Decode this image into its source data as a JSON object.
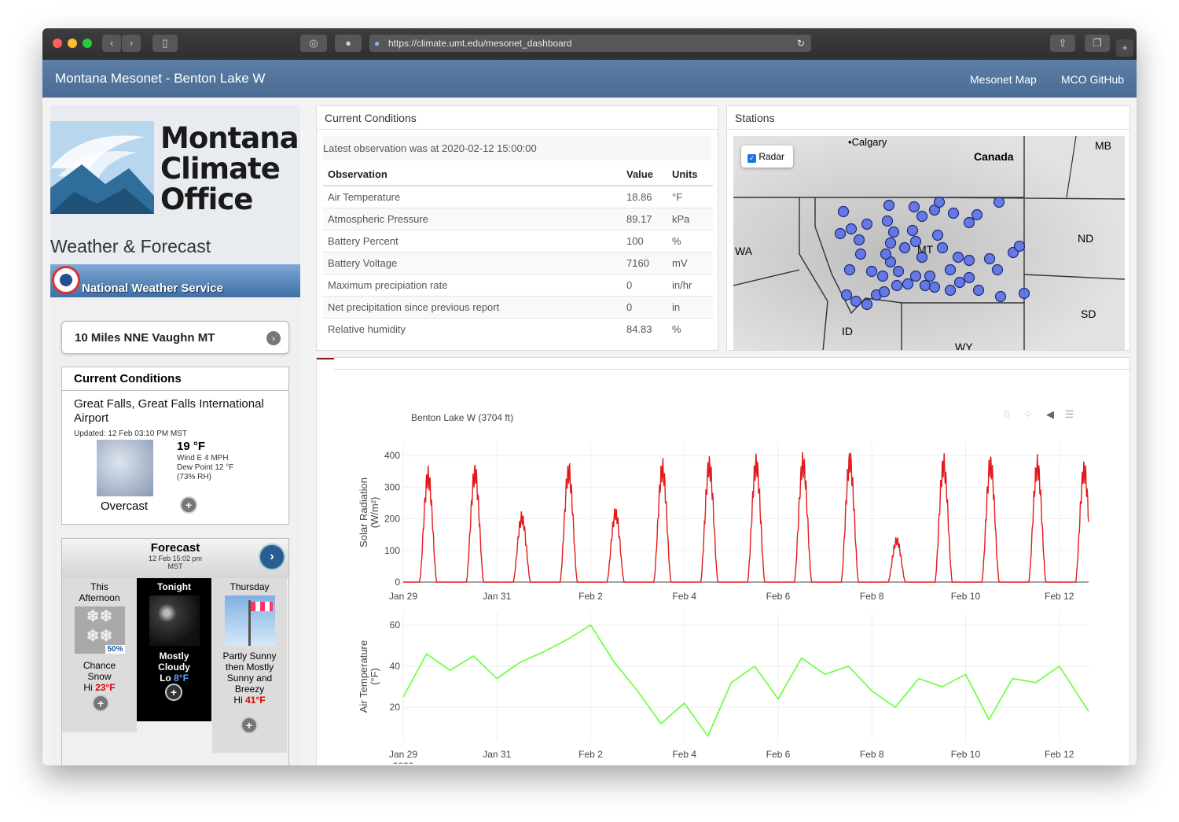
{
  "browser": {
    "url": "https://climate.umt.edu/mesonet_dashboard"
  },
  "app": {
    "title": "Montana Mesonet - Benton Lake W",
    "nav": [
      "Mesonet Map",
      "MCO GitHub"
    ]
  },
  "sidebar": {
    "logo_text": [
      "Montana",
      "Climate",
      "Office"
    ],
    "section_title": "Weather & Forecast",
    "nws_banner": "National Weather Service",
    "location": "10 Miles NNE Vaughn MT",
    "current": {
      "heading": "Current Conditions",
      "station": "Great Falls, Great Falls International Airport",
      "updated": "Updated: 12 Feb 03:10 PM MST",
      "temp": "19 °F",
      "wind": "Wind E 4 MPH",
      "dewpoint": "Dew Point 12 °F",
      "rh": "(73% RH)",
      "condition": "Overcast"
    },
    "forecast": {
      "heading": "Forecast",
      "updated": "12 Feb 15:02 pm",
      "tz": "MST",
      "periods": [
        {
          "name": "This Afternoon",
          "pop": "50%",
          "desc": "Chance Snow",
          "temp_label": "Hi",
          "temp": "23°F"
        },
        {
          "name": "Tonight",
          "desc": "Mostly Cloudy",
          "temp_label": "Lo",
          "temp": "8°F"
        },
        {
          "name": "Thursday",
          "desc": "Partly Sunny then Mostly Sunny and Breezy",
          "temp_label": "Hi",
          "temp": "41°F"
        }
      ]
    }
  },
  "conditions": {
    "heading": "Current Conditions",
    "latest": "Latest observation was at 2020-02-12 15:00:00",
    "columns": [
      "Observation",
      "Value",
      "Units"
    ],
    "rows": [
      [
        "Air Temperature",
        "18.86",
        "°F"
      ],
      [
        "Atmospheric Pressure",
        "89.17",
        "kPa"
      ],
      [
        "Battery Percent",
        "100",
        "%"
      ],
      [
        "Battery Voltage",
        "7160",
        "mV"
      ],
      [
        "Maximum precipiation rate",
        "0",
        "in/hr"
      ],
      [
        "Net precipitation since previous report",
        "0",
        "in"
      ],
      [
        "Relative humidity",
        "84.83",
        "%"
      ]
    ]
  },
  "stations": {
    "heading": "Stations",
    "radar_label": "Radar",
    "map_labels": [
      "Calgary",
      "Canada",
      "MB",
      "WA",
      "MT",
      "ND",
      "SD",
      "ID",
      "WY"
    ]
  },
  "chart_data": [
    {
      "type": "line",
      "title": "Benton Lake W (3704 ft)",
      "ylabel": "Solar Radiation (W/m²)",
      "ylim": [
        0,
        440
      ],
      "yticks": [
        0,
        100,
        200,
        300,
        400
      ],
      "xticks": [
        "Jan 29\n2020",
        "Jan 31",
        "Feb 2",
        "Feb 4",
        "Feb 6",
        "Feb 8",
        "Feb 10",
        "Feb 12"
      ],
      "series": [
        {
          "color": "#e31a1c",
          "daily_peaks": [
            {
              "day": "2020-01-29",
              "peak": 370
            },
            {
              "day": "2020-01-30",
              "peak": 380
            },
            {
              "day": "2020-01-31",
              "peak": 225
            },
            {
              "day": "2020-02-01",
              "peak": 385
            },
            {
              "day": "2020-02-02",
              "peak": 240
            },
            {
              "day": "2020-02-03",
              "peak": 395
            },
            {
              "day": "2020-02-04",
              "peak": 405
            },
            {
              "day": "2020-02-05",
              "peak": 410
            },
            {
              "day": "2020-02-06",
              "peak": 415
            },
            {
              "day": "2020-02-07",
              "peak": 420
            },
            {
              "day": "2020-02-08",
              "peak": 145
            },
            {
              "day": "2020-02-09",
              "peak": 410
            },
            {
              "day": "2020-02-10",
              "peak": 410
            },
            {
              "day": "2020-02-11",
              "peak": 405
            },
            {
              "day": "2020-02-12",
              "peak": 390
            }
          ]
        }
      ]
    },
    {
      "type": "line",
      "ylabel": "Air Temperature (°F)",
      "ylim": [
        4,
        66
      ],
      "yticks": [
        20,
        40,
        60
      ],
      "xticks": [
        "Jan 29\n2020",
        "Jan 31",
        "Feb 2",
        "Feb 4",
        "Feb 6",
        "Feb 8",
        "Feb 10",
        "Feb 12"
      ],
      "series": [
        {
          "color": "#66ff33",
          "x": [
            "2020-01-29",
            "2020-01-29T12",
            "2020-01-30",
            "2020-01-30T12",
            "2020-01-31",
            "2020-01-31T12",
            "2020-02-01",
            "2020-02-01T12",
            "2020-02-02",
            "2020-02-02T12",
            "2020-02-03",
            "2020-02-03T12",
            "2020-02-04",
            "2020-02-04T12",
            "2020-02-05",
            "2020-02-05T12",
            "2020-02-06",
            "2020-02-06T12",
            "2020-02-07",
            "2020-02-07T12",
            "2020-02-08",
            "2020-02-08T12",
            "2020-02-09",
            "2020-02-09T12",
            "2020-02-10",
            "2020-02-10T12",
            "2020-02-11",
            "2020-02-11T12",
            "2020-02-12",
            "2020-02-12T15"
          ],
          "y": [
            25,
            46,
            38,
            45,
            34,
            42,
            47,
            53,
            60,
            42,
            28,
            12,
            22,
            6,
            32,
            40,
            24,
            44,
            36,
            40,
            28,
            20,
            34,
            30,
            36,
            14,
            34,
            32,
            40,
            18
          ]
        }
      ]
    }
  ]
}
